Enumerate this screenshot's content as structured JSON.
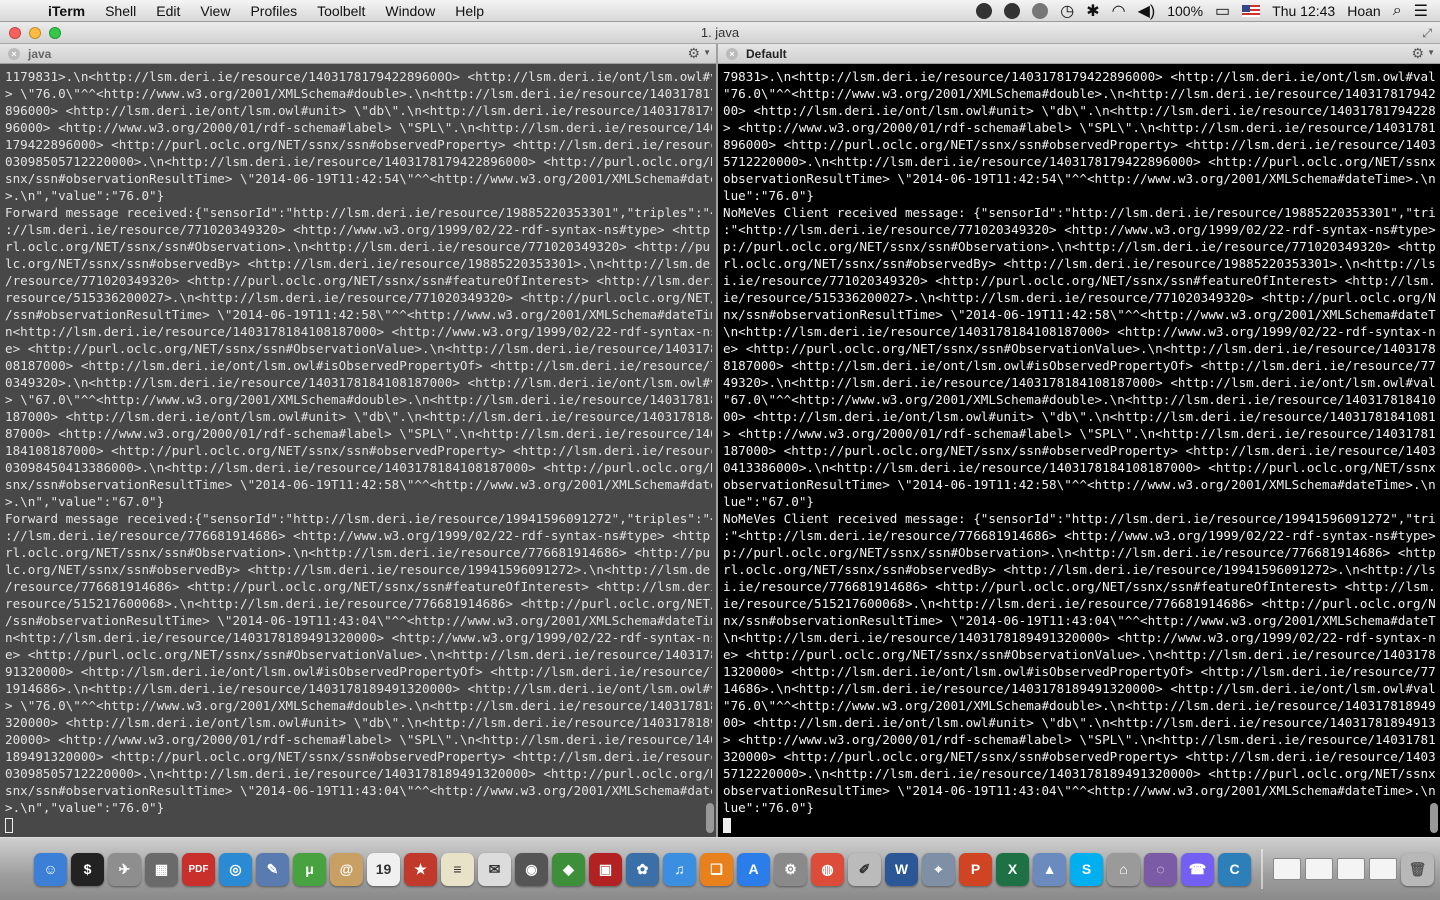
{
  "menubar": {
    "app_name": "iTerm",
    "menus": [
      "Shell",
      "Edit",
      "View",
      "Profiles",
      "Toolbelt",
      "Window",
      "Help"
    ],
    "battery": "100%",
    "clock": "Thu 12:43",
    "user": "Hoan"
  },
  "window": {
    "title": "1. java"
  },
  "left_pane": {
    "name": "java",
    "lines": [
      "1179831>.\\n<http://lsm.deri.ie/resource/140317817942289600O> <http://lsm.deri.ie/ont/lsm.owl#value",
      "> \\\"76.0\\\"^^<http://www.w3.org/2001/XMLSchema#double>.\\n<http://lsm.deri.ie/resource/1403178179422",
      "896000> <http://lsm.deri.ie/ont/lsm.owl#unit> \\\"db\\\".\\n<http://lsm.deri.ie/resource/14031781794228",
      "96000> <http://www.w3.org/2000/01/rdf-schema#label> \\\"SPL\\\".\\n<http://lsm.deri.ie/resource/1403178",
      "179422896000> <http://purl.oclc.org/NET/ssnx/ssn#observedProperty> <http://lsm.deri.ie/resource/14",
      "03098505712220000>.\\n<http://lsm.deri.ie/resource/1403178179422896000> <http://purl.oclc.org/NET/s",
      "snx/ssn#observationResultTime> \\\"2014-06-19T11:42:54\\\"^^<http://www.w3.org/2001/XMLSchema#dateTime",
      ">.\\n\",\"value\":\"76.0\"}",
      "Forward message received:{\"sensorId\":\"http://lsm.deri.ie/resource/19885220353301\",\"triples\":\"<http",
      "://lsm.deri.ie/resource/771020349320> <http://www.w3.org/1999/02/22-rdf-syntax-ns#type> <http://pu",
      "rl.oclc.org/NET/ssnx/ssn#Observation>.\\n<http://lsm.deri.ie/resource/771020349320> <http://purl.oc",
      "lc.org/NET/ssnx/ssn#observedBy> <http://lsm.deri.ie/resource/19885220353301>.\\n<http://lsm.deri.ie",
      "/resource/771020349320> <http://purl.oclc.org/NET/ssnx/ssn#featureOfInterest> <http://lsm.deri.ie/",
      "resource/515336200027>.\\n<http://lsm.deri.ie/resource/771020349320> <http://purl.oclc.org/NET/ssnx",
      "/ssn#observationResultTime> \\\"2014-06-19T11:42:58\\\"^^<http://www.w3.org/2001/XMLSchema#dateTime>.\\",
      "n<http://lsm.deri.ie/resource/1403178184108187000> <http://www.w3.org/1999/02/22-rdf-syntax-ns#typ",
      "e> <http://purl.oclc.org/NET/ssnx/ssn#ObservationValue>.\\n<http://lsm.deri.ie/resource/14031781841",
      "08187000> <http://lsm.deri.ie/ont/lsm.owl#isObservedPropertyOf> <http://lsm.deri.ie/resource/77102",
      "0349320>.\\n<http://lsm.deri.ie/resource/1403178184108187000> <http://lsm.deri.ie/ont/lsm.owl#value",
      "> \\\"67.0\\\"^^<http://www.w3.org/2001/XMLSchema#double>.\\n<http://lsm.deri.ie/resource/1403178184108",
      "187000> <http://lsm.deri.ie/ont/lsm.owl#unit> \\\"db\\\".\\n<http://lsm.deri.ie/resource/14031781841081",
      "87000> <http://www.w3.org/2000/01/rdf-schema#label> \\\"SPL\\\".\\n<http://lsm.deri.ie/resource/1403178",
      "184108187000> <http://purl.oclc.org/NET/ssnx/ssn#observedProperty> <http://lsm.deri.ie/resource/14",
      "03098450413386000>.\\n<http://lsm.deri.ie/resource/1403178184108187000> <http://purl.oclc.org/NET/s",
      "snx/ssn#observationResultTime> \\\"2014-06-19T11:42:58\\\"^^<http://www.w3.org/2001/XMLSchema#dateTime",
      ">.\\n\",\"value\":\"67.0\"}",
      "Forward message received:{\"sensorId\":\"http://lsm.deri.ie/resource/19941596091272\",\"triples\":\"<http",
      "://lsm.deri.ie/resource/776681914686> <http://www.w3.org/1999/02/22-rdf-syntax-ns#type> <http://pu",
      "rl.oclc.org/NET/ssnx/ssn#Observation>.\\n<http://lsm.deri.ie/resource/776681914686> <http://purl.oc",
      "lc.org/NET/ssnx/ssn#observedBy> <http://lsm.deri.ie/resource/19941596091272>.\\n<http://lsm.deri.ie",
      "/resource/776681914686> <http://purl.oclc.org/NET/ssnx/ssn#featureOfInterest> <http://lsm.deri.ie/",
      "resource/515217600068>.\\n<http://lsm.deri.ie/resource/776681914686> <http://purl.oclc.org/NET/ssnx",
      "/ssn#observationResultTime> \\\"2014-06-19T11:43:04\\\"^^<http://www.w3.org/2001/XMLSchema#dateTime>.\\",
      "n<http://lsm.deri.ie/resource/1403178189491320000> <http://www.w3.org/1999/02/22-rdf-syntax-ns#typ",
      "e> <http://purl.oclc.org/NET/ssnx/ssn#ObservationValue>.\\n<http://lsm.deri.ie/resource/14031781894",
      "91320000> <http://lsm.deri.ie/ont/lsm.owl#isObservedPropertyOf> <http://lsm.deri.ie/resource/77668",
      "1914686>.\\n<http://lsm.deri.ie/resource/1403178189491320000> <http://lsm.deri.ie/ont/lsm.owl#value",
      "> \\\"76.0\\\"^^<http://www.w3.org/2001/XMLSchema#double>.\\n<http://lsm.deri.ie/resource/1403178189491",
      "320000> <http://lsm.deri.ie/ont/lsm.owl#unit> \\\"db\\\".\\n<http://lsm.deri.ie/resource/14031781894913",
      "20000> <http://www.w3.org/2000/01/rdf-schema#label> \\\"SPL\\\".\\n<http://lsm.deri.ie/resource/1403178",
      "189491320000> <http://purl.oclc.org/NET/ssnx/ssn#observedProperty> <http://lsm.deri.ie/resource/14",
      "03098505712220000>.\\n<http://lsm.deri.ie/resource/1403178189491320000> <http://purl.oclc.org/NET/s",
      "snx/ssn#observationResultTime> \\\"2014-06-19T11:43:04\\\"^^<http://www.w3.org/2001/XMLSchema#dateTime",
      ">.\\n\",\"value\":\"76.0\"}"
    ]
  },
  "right_pane": {
    "name": "Default",
    "lines": [
      "79831>.\\n<http://lsm.deri.ie/resource/1403178179422896000> <http://lsm.deri.ie/ont/lsm.owl#value> \\",
      "\"76.0\\\"^^<http://www.w3.org/2001/XMLSchema#double>.\\n<http://lsm.deri.ie/resource/14031781794228960",
      "00> <http://lsm.deri.ie/ont/lsm.owl#unit> \\\"db\\\".\\n<http://lsm.deri.ie/resource/1403178179422896000",
      "> <http://www.w3.org/2000/01/rdf-schema#label> \\\"SPL\\\".\\n<http://lsm.deri.ie/resource/1403178179422",
      "896000> <http://purl.oclc.org/NET/ssnx/ssn#observedProperty> <http://lsm.deri.ie/resource/140309850",
      "5712220000>.\\n<http://lsm.deri.ie/resource/1403178179422896000> <http://purl.oclc.org/NET/ssnx/ssn#",
      "observationResultTime> \\\"2014-06-19T11:42:54\\\"^^<http://www.w3.org/2001/XMLSchema#dateTime>.\\n\",\"va",
      "lue\":\"76.0\"}",
      "NoMeVes Client received message: {\"sensorId\":\"http://lsm.deri.ie/resource/19885220353301\",\"triples\"",
      ":\"<http://lsm.deri.ie/resource/771020349320> <http://www.w3.org/1999/02/22-rdf-syntax-ns#type> <htt",
      "p://purl.oclc.org/NET/ssnx/ssn#Observation>.\\n<http://lsm.deri.ie/resource/771020349320> <http://pu",
      "rl.oclc.org/NET/ssnx/ssn#observedBy> <http://lsm.deri.ie/resource/19885220353301>.\\n<http://lsm.der",
      "i.ie/resource/771020349320> <http://purl.oclc.org/NET/ssnx/ssn#featureOfInterest> <http://lsm.deri.",
      "ie/resource/515336200027>.\\n<http://lsm.deri.ie/resource/771020349320> <http://purl.oclc.org/NET/ss",
      "nx/ssn#observationResultTime> \\\"2014-06-19T11:42:58\\\"^^<http://www.w3.org/2001/XMLSchema#dateTime>.",
      "\\n<http://lsm.deri.ie/resource/1403178184108187000> <http://www.w3.org/1999/02/22-rdf-syntax-ns#typ",
      "e> <http://purl.oclc.org/NET/ssnx/ssn#ObservationValue>.\\n<http://lsm.deri.ie/resource/140317818410",
      "8187000> <http://lsm.deri.ie/ont/lsm.owl#isObservedPropertyOf> <http://lsm.deri.ie/resource/7710203",
      "49320>.\\n<http://lsm.deri.ie/resource/1403178184108187000> <http://lsm.deri.ie/ont/lsm.owl#value> \\",
      "\"67.0\\\"^^<http://www.w3.org/2001/XMLSchema#double>.\\n<http://lsm.deri.ie/resource/14031781841081870",
      "00> <http://lsm.deri.ie/ont/lsm.owl#unit> \\\"db\\\".\\n<http://lsm.deri.ie/resource/1403178184108187000",
      "> <http://www.w3.org/2000/01/rdf-schema#label> \\\"SPL\\\".\\n<http://lsm.deri.ie/resource/1403178184108",
      "187000> <http://purl.oclc.org/NET/ssnx/ssn#observedProperty> <http://lsm.deri.ie/resource/140309845",
      "0413386000>.\\n<http://lsm.deri.ie/resource/1403178184108187000> <http://purl.oclc.org/NET/ssnx/ssn#",
      "observationResultTime> \\\"2014-06-19T11:42:58\\\"^^<http://www.w3.org/2001/XMLSchema#dateTime>.\\n\",\"va",
      "lue\":\"67.0\"}",
      "NoMeVes Client received message: {\"sensorId\":\"http://lsm.deri.ie/resource/19941596091272\",\"triples\"",
      ":\"<http://lsm.deri.ie/resource/776681914686> <http://www.w3.org/1999/02/22-rdf-syntax-ns#type> <htt",
      "p://purl.oclc.org/NET/ssnx/ssn#Observation>.\\n<http://lsm.deri.ie/resource/776681914686> <http://pu",
      "rl.oclc.org/NET/ssnx/ssn#observedBy> <http://lsm.deri.ie/resource/19941596091272>.\\n<http://lsm.der",
      "i.ie/resource/776681914686> <http://purl.oclc.org/NET/ssnx/ssn#featureOfInterest> <http://lsm.deri.",
      "ie/resource/515217600068>.\\n<http://lsm.deri.ie/resource/776681914686> <http://purl.oclc.org/NET/ss",
      "nx/ssn#observationResultTime> \\\"2014-06-19T11:43:04\\\"^^<http://www.w3.org/2001/XMLSchema#dateTime>.",
      "\\n<http://lsm.deri.ie/resource/1403178189491320000> <http://www.w3.org/1999/02/22-rdf-syntax-ns#typ",
      "e> <http://purl.oclc.org/NET/ssnx/ssn#ObservationValue>.\\n<http://lsm.deri.ie/resource/140317818949",
      "1320000> <http://lsm.deri.ie/ont/lsm.owl#isObservedPropertyOf> <http://lsm.deri.ie/resource/7766819",
      "14686>.\\n<http://lsm.deri.ie/resource/1403178189491320000> <http://lsm.deri.ie/ont/lsm.owl#value> \\",
      "\"76.0\\\"^^<http://www.w3.org/2001/XMLSchema#double>.\\n<http://lsm.deri.ie/resource/14031781894913200",
      "00> <http://lsm.deri.ie/ont/lsm.owl#unit> \\\"db\\\".\\n<http://lsm.deri.ie/resource/1403178189491320000",
      "> <http://www.w3.org/2000/01/rdf-schema#label> \\\"SPL\\\".\\n<http://lsm.deri.ie/resource/1403178189491",
      "320000> <http://purl.oclc.org/NET/ssnx/ssn#observedProperty> <http://lsm.deri.ie/resource/140309850",
      "5712220000>.\\n<http://lsm.deri.ie/resource/1403178189491320000> <http://purl.oclc.org/NET/ssnx/ssn#",
      "observationResultTime> \\\"2014-06-19T11:43:04\\\"^^<http://www.w3.org/2001/XMLSchema#dateTime>.\\n\",\"va",
      "lue\":\"76.0\"}"
    ]
  },
  "dock": {
    "pdf_label": "PDF",
    "calendar_day": "19",
    "items": [
      {
        "name": "finder",
        "color": "#3b7fd6",
        "glyph": "☺"
      },
      {
        "name": "terminal",
        "color": "#222222",
        "glyph": "$"
      },
      {
        "name": "launchpad",
        "color": "#8e8e8e",
        "glyph": "✈"
      },
      {
        "name": "utilities",
        "color": "#6a6a6a",
        "glyph": "▦"
      },
      {
        "name": "pdf",
        "color": "#c9302c",
        "glyph": "PDF"
      },
      {
        "name": "safari",
        "color": "#2a8ad4",
        "glyph": "◎"
      },
      {
        "name": "preview",
        "color": "#5a7bb0",
        "glyph": "✎"
      },
      {
        "name": "utorrent",
        "color": "#48a23f",
        "glyph": "μ"
      },
      {
        "name": "contacts",
        "color": "#c8a063",
        "glyph": "@"
      },
      {
        "name": "calendar",
        "color": "#f0f0f0",
        "glyph": "19"
      },
      {
        "name": "photo-booth",
        "color": "#c0392b",
        "glyph": "★"
      },
      {
        "name": "notes",
        "color": "#e8e2c8",
        "glyph": "≡"
      },
      {
        "name": "textedit",
        "color": "#dcdcdc",
        "glyph": "✉"
      },
      {
        "name": "facetime",
        "color": "#555555",
        "glyph": "◉"
      },
      {
        "name": "layers",
        "color": "#3d8f3a",
        "glyph": "◆"
      },
      {
        "name": "photo-viewer",
        "color": "#b22222",
        "glyph": "▣"
      },
      {
        "name": "iphoto",
        "color": "#3a6fa8",
        "glyph": "✿"
      },
      {
        "name": "itunes",
        "color": "#3b8fe0",
        "glyph": "♫"
      },
      {
        "name": "ibooks",
        "color": "#e8801c",
        "glyph": "❏"
      },
      {
        "name": "app-store",
        "color": "#2b7de9",
        "glyph": "A"
      },
      {
        "name": "system-preferences",
        "color": "#8a8a8a",
        "glyph": "⚙"
      },
      {
        "name": "chrome",
        "color": "#dd4b39",
        "glyph": "◍"
      },
      {
        "name": "script-editor",
        "color": "#bbbbbb",
        "glyph": "✐"
      },
      {
        "name": "word",
        "color": "#2b5797",
        "glyph": "W"
      },
      {
        "name": "image-capture",
        "color": "#7f8fa6",
        "glyph": "⌖"
      },
      {
        "name": "powerpoint",
        "color": "#d04423",
        "glyph": "P"
      },
      {
        "name": "excel",
        "color": "#1e7145",
        "glyph": "X"
      },
      {
        "name": "keynote",
        "color": "#6b8bbf",
        "glyph": "▲"
      },
      {
        "name": "skype",
        "color": "#00aff0",
        "glyph": "S"
      },
      {
        "name": "archive",
        "color": "#9a9a9a",
        "glyph": "⌂"
      },
      {
        "name": "network-radar",
        "color": "#7b5aa6",
        "glyph": "◌"
      },
      {
        "name": "viber",
        "color": "#7360f2",
        "glyph": "☎"
      },
      {
        "name": "cyberduck",
        "color": "#2c7fb8",
        "glyph": "C"
      }
    ]
  }
}
